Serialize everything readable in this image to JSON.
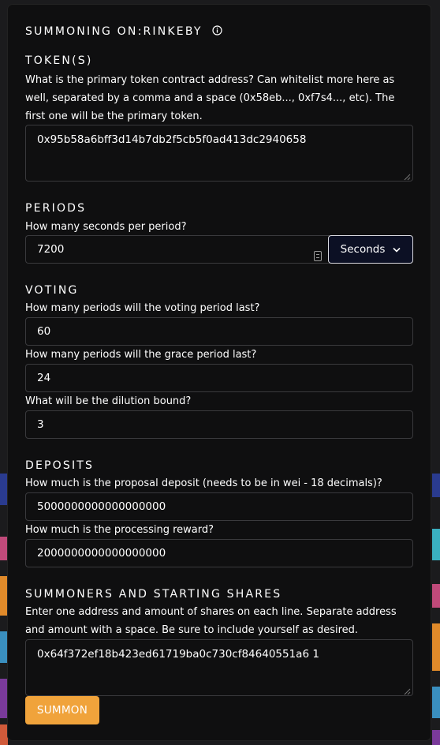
{
  "header": {
    "title": "SUMMONING ON:RINKEBY",
    "info_icon": "info-circle-icon"
  },
  "token": {
    "title": "TOKEN(S)",
    "help": "What is the primary token contract address? Can whitelist more here as well, separated by a comma and a space (0x58eb..., 0xf7s4..., etc). The first one will be the primary token.",
    "value": "0x95b58a6bff3d14b7db2f5cb5f0ad413dc2940658"
  },
  "periods": {
    "title": "PERIODS",
    "help": "How many seconds per period?",
    "value": "7200",
    "unit_label": "Seconds",
    "unit_icon": "chevron-down-icon"
  },
  "voting": {
    "title": "VOTING",
    "voting_help": "How many periods will the voting period last?",
    "voting_value": "60",
    "grace_help": "How many periods will the grace period last?",
    "grace_value": "24",
    "dilution_help": "What will be the dilution bound?",
    "dilution_value": "3"
  },
  "deposits": {
    "title": "DEPOSITS",
    "proposal_help": "How much is the proposal deposit (needs to be in wei - 18 decimals)?",
    "proposal_value": "5000000000000000000",
    "reward_help": "How much is the processing reward?",
    "reward_value": "2000000000000000000"
  },
  "summoners": {
    "title": "SUMMONERS AND STARTING SHARES",
    "help": "Enter one address and amount of shares on each line. Separate address and amount with a space. Be sure to include yourself as desired.",
    "value": "0x64f372ef18b423ed61719ba0c730cf84640551a6 1"
  },
  "submit_label": "SUMMON",
  "colors": {
    "accent": "#f0a33b",
    "panel": "#0f0f10",
    "select_bg": "#0c1024"
  }
}
